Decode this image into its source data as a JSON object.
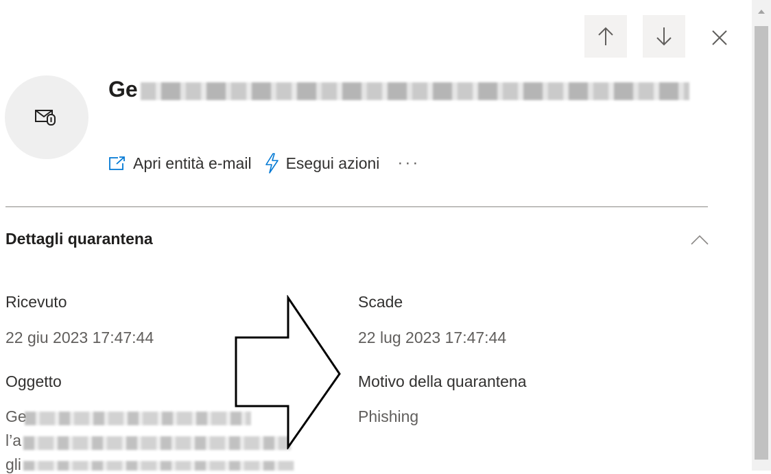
{
  "header": {
    "title_visible": "Ge",
    "actions": [
      {
        "label": "Apri entità e-mail",
        "icon": "open-external-icon"
      },
      {
        "label": "Esegui azioni",
        "icon": "lightning-icon"
      }
    ],
    "more_label": "···"
  },
  "nav": {
    "up_icon": "arrow-up-icon",
    "down_icon": "arrow-down-icon",
    "close_icon": "close-icon"
  },
  "section": {
    "title": "Dettagli quarantena",
    "fields": {
      "received_label": "Ricevuto",
      "received_value": "22 giu 2023 17:47:44",
      "expires_label": "Scade",
      "expires_value": "22 lug 2023 17:47:44",
      "subject_label": "Oggetto",
      "subject_lines": [
        "Ge",
        "l’a",
        "gli"
      ],
      "reason_label": "Motivo della quarantena",
      "reason_value": "Phishing"
    }
  },
  "colors": {
    "accent": "#0078d4",
    "button_bg": "#f3f2f1",
    "avatar_bg": "#efefef"
  }
}
